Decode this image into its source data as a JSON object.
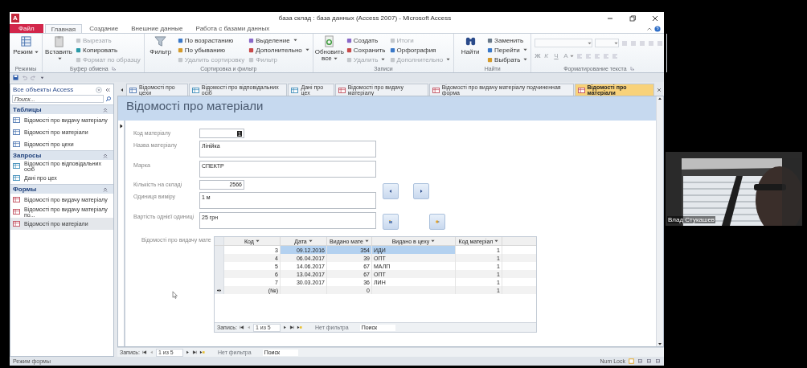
{
  "window": {
    "app_badge": "A",
    "title": "база склад : база данных (Access 2007)  -  Microsoft Access"
  },
  "ribbon_tabs": [
    {
      "label": "Файл",
      "kind": "file",
      "selected": false
    },
    {
      "label": "Главная",
      "kind": "tab",
      "selected": true
    },
    {
      "label": "Создание",
      "kind": "tab",
      "selected": false
    },
    {
      "label": "Внешние данные",
      "kind": "tab",
      "selected": false
    },
    {
      "label": "Работа с базами данных",
      "kind": "tab",
      "selected": false
    }
  ],
  "ribbon_groups": [
    {
      "label": "Режимы",
      "kind": "commands",
      "launcher": false,
      "items": [
        {
          "label": "Режим",
          "kind": "large",
          "caret": true,
          "disabled": false
        }
      ]
    },
    {
      "label": "Буфер обмена",
      "kind": "commands",
      "launcher": true,
      "items": [
        {
          "label": "Вставить",
          "kind": "large",
          "caret": true,
          "disabled": false
        },
        {
          "label": "Вырезать",
          "kind": "small",
          "caret": false,
          "disabled": true
        },
        {
          "label": "Копировать",
          "kind": "small",
          "caret": false,
          "disabled": false
        },
        {
          "label": "Формат по образцу",
          "kind": "small",
          "caret": false,
          "disabled": true
        }
      ]
    },
    {
      "label": "Сортировка и фильтр",
      "kind": "commands",
      "launcher": false,
      "items": [
        {
          "label": "Фильтр",
          "kind": "large",
          "caret": false,
          "disabled": false
        },
        {
          "label": "По возрастанию",
          "kind": "small",
          "caret": false,
          "disabled": false
        },
        {
          "label": "По убыванию",
          "kind": "small",
          "caret": false,
          "disabled": false
        },
        {
          "label": "Удалить сортировку",
          "kind": "small",
          "caret": false,
          "disabled": true
        },
        {
          "label": "Выделение",
          "kind": "small",
          "caret": true,
          "disabled": false
        },
        {
          "label": "Дополнительно",
          "kind": "small",
          "caret": true,
          "disabled": false
        },
        {
          "label": "Фильтр",
          "kind": "small",
          "caret": false,
          "disabled": true
        }
      ]
    },
    {
      "label": "Записи",
      "kind": "commands",
      "launcher": false,
      "items": [
        {
          "label": "Обновить все",
          "kind": "large",
          "caret": true,
          "disabled": false
        },
        {
          "label": "Создать",
          "kind": "small",
          "caret": false,
          "disabled": false
        },
        {
          "label": "Сохранить",
          "kind": "small",
          "caret": false,
          "disabled": false
        },
        {
          "label": "Удалить",
          "kind": "small",
          "caret": true,
          "disabled": true
        },
        {
          "label": "Итоги",
          "kind": "small",
          "caret": false,
          "disabled": true
        },
        {
          "label": "Орфография",
          "kind": "small",
          "caret": false,
          "disabled": false
        },
        {
          "label": "Дополнительно",
          "kind": "small",
          "caret": true,
          "disabled": true
        }
      ]
    },
    {
      "label": "Найти",
      "kind": "commands",
      "launcher": false,
      "items": [
        {
          "label": "Найти",
          "kind": "large",
          "caret": false,
          "disabled": false
        },
        {
          "label": "Заменить",
          "kind": "small",
          "caret": false,
          "disabled": false
        },
        {
          "label": "Перейти",
          "kind": "small",
          "caret": true,
          "disabled": false
        },
        {
          "label": "Выбрать",
          "kind": "small",
          "caret": true,
          "disabled": false
        }
      ]
    },
    {
      "label": "Форматирование текста",
      "kind": "format",
      "launcher": true,
      "items": [
        {
          "label": "Ж",
          "caret": false,
          "disabled": true
        },
        {
          "label": "К",
          "caret": false,
          "disabled": true
        },
        {
          "label": "Ч",
          "caret": false,
          "disabled": true
        },
        {
          "label": "A",
          "caret": true,
          "disabled": true
        }
      ]
    }
  ],
  "navigation_pane": {
    "title": "Все объекты Access",
    "search": {
      "placeholder": "Поиск..."
    },
    "groups": [
      {
        "label": "Таблицы",
        "kind": "table",
        "expanded": true,
        "items": [
          {
            "label": "Відомості про видачу матеріалу",
            "selected": false
          },
          {
            "label": "Відомості про матеріали",
            "selected": false
          },
          {
            "label": "Відомості про цехи",
            "selected": false
          }
        ]
      },
      {
        "label": "Запросы",
        "kind": "query",
        "expanded": true,
        "items": [
          {
            "label": "Відомості про відповідальних осіб",
            "selected": false
          },
          {
            "label": "Дані про цех",
            "selected": false
          }
        ]
      },
      {
        "label": "Формы",
        "kind": "form",
        "expanded": true,
        "items": [
          {
            "label": "Відомості про видачу матеріалу",
            "selected": false
          },
          {
            "label": "Відомості про видачу матеріалу по...",
            "selected": false
          },
          {
            "label": "Відомості про матеріали",
            "selected": true
          }
        ]
      }
    ]
  },
  "document_tabs": [
    {
      "label": "Відомості про цехи",
      "kind": "table",
      "selected": false
    },
    {
      "label": "Відомості про відповідальних осіб",
      "kind": "query",
      "selected": false
    },
    {
      "label": "Дані про цех",
      "kind": "query",
      "selected": false
    },
    {
      "label": "Відомості про видачу матеріалу",
      "kind": "form",
      "selected": false
    },
    {
      "label": "Відомості про видачу матеріалу подчиненная форма",
      "kind": "form",
      "selected": false
    },
    {
      "label": "Відомості про матеріали",
      "kind": "form",
      "selected": true
    }
  ],
  "form": {
    "title": "Відомості про матеріали",
    "fields": [
      {
        "label": "Код матеріалу",
        "value": "1",
        "kind": "number",
        "highlighted": true
      },
      {
        "label": "Назва матеріалу",
        "value": "Лінійка",
        "kind": "text",
        "highlighted": false
      },
      {
        "label": "Марка",
        "value": "СПЕКТР",
        "kind": "text",
        "highlighted": false
      },
      {
        "label": "Кількість на складі",
        "value": "2566",
        "kind": "number",
        "highlighted": false
      },
      {
        "label": "Одиниця виміру",
        "value": "1 м",
        "kind": "text",
        "highlighted": false
      },
      {
        "label": "Вартість однієї одиниці",
        "value": "25 грн",
        "kind": "text",
        "highlighted": false
      }
    ],
    "subform": {
      "label": "Відомості про видачу мате",
      "columns": [
        "Код",
        "Дата",
        "Видано мате",
        "Видано в цеху",
        "Код матеріал"
      ],
      "rows": [
        {
          "kind": "record",
          "selected": true,
          "code": "3",
          "date": "09.12.2016",
          "issued": "354",
          "workshop": "ИДИ",
          "material_code": "1"
        },
        {
          "kind": "record",
          "selected": false,
          "code": "4",
          "date": "06.04.2017",
          "issued": "39",
          "workshop": "ОПТ",
          "material_code": "1"
        },
        {
          "kind": "record",
          "selected": false,
          "code": "5",
          "date": "14.06.2017",
          "issued": "67",
          "workshop": "МАЛП",
          "material_code": "1"
        },
        {
          "kind": "record",
          "selected": false,
          "code": "6",
          "date": "13.04.2017",
          "issued": "67",
          "workshop": "ОПТ",
          "material_code": "1"
        },
        {
          "kind": "record",
          "selected": false,
          "code": "7",
          "date": "30.03.2017",
          "issued": "36",
          "workshop": "ЛИН",
          "material_code": "1"
        },
        {
          "kind": "new",
          "selected": false,
          "code": "(№)",
          "issued": "0",
          "material_code": "1"
        }
      ],
      "navigator": {
        "label": "Запись:",
        "position": "1 из 5",
        "filter": "Нет фильтра",
        "search": {
          "placeholder": "Поиск"
        }
      }
    },
    "navigator": {
      "label": "Запись:",
      "position": "1 из 5",
      "filter": "Нет фильтра",
      "search": {
        "placeholder": "Поиск"
      }
    }
  },
  "status_bar": {
    "mode": "Режим формы",
    "num_lock": "Num Lock"
  },
  "video_tile": {
    "name": "Влад Стукашев"
  }
}
